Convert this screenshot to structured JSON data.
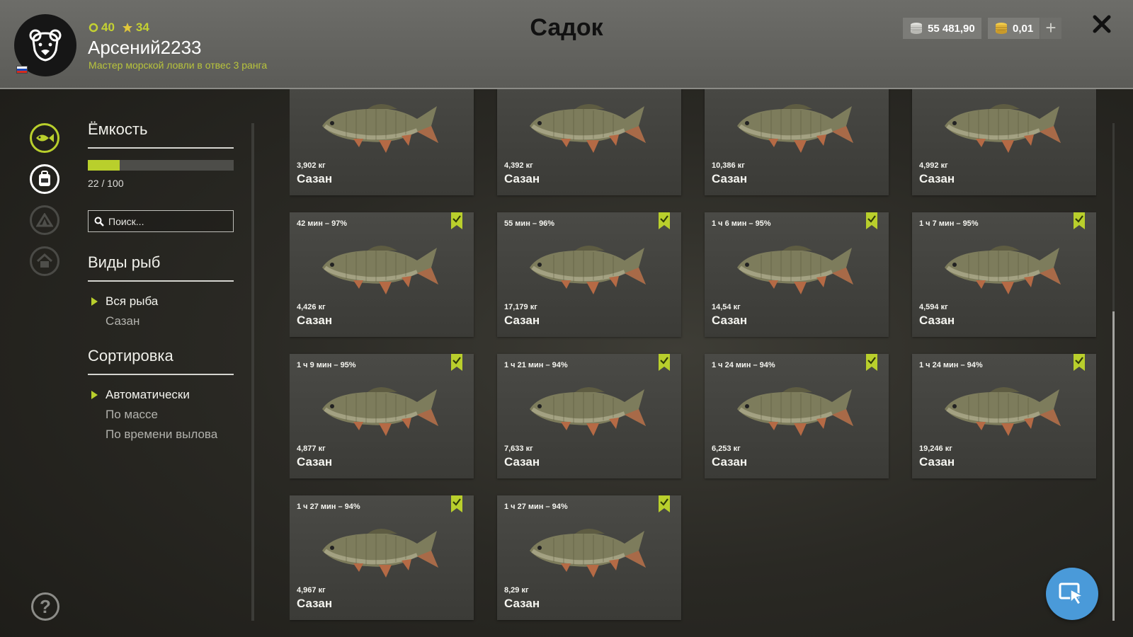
{
  "header": {
    "title": "Садок",
    "player": {
      "name": "Арсений2233",
      "rank": "Мастер морской ловли в отвес 3 ранга",
      "level": "40",
      "stars": "34",
      "avatar_icon": "bear-icon",
      "flag": "russia-flag-icon"
    },
    "currency": {
      "silver": "55 481,90",
      "gold": "0,01",
      "add_label": "+"
    }
  },
  "nav": {
    "items": [
      {
        "icon": "fish-icon",
        "state": "active"
      },
      {
        "icon": "backpack-icon",
        "state": "normal"
      },
      {
        "icon": "tent-icon",
        "state": "disabled"
      },
      {
        "icon": "house-icon",
        "state": "disabled"
      }
    ],
    "help_label": "?"
  },
  "capacity": {
    "title": "Ёмкость",
    "used": 22,
    "total": 100,
    "text": "22 / 100",
    "fill_fraction": 0.22
  },
  "search": {
    "placeholder": "Поиск..."
  },
  "species": {
    "title": "Виды рыб",
    "options": [
      {
        "label": "Вся рыба",
        "active": true
      },
      {
        "label": "Сазан",
        "active": false
      }
    ]
  },
  "sorting": {
    "title": "Сортировка",
    "options": [
      {
        "label": "Автоматически",
        "active": true
      },
      {
        "label": "По массе",
        "active": false
      },
      {
        "label": "По времени вылова",
        "active": false
      }
    ]
  },
  "fish": [
    {
      "time": "",
      "weight": "3,902 кг",
      "name": "Сазан",
      "bookmarked": false
    },
    {
      "time": "",
      "weight": "4,392 кг",
      "name": "Сазан",
      "bookmarked": false
    },
    {
      "time": "",
      "weight": "10,386 кг",
      "name": "Сазан",
      "bookmarked": false
    },
    {
      "time": "",
      "weight": "4,992 кг",
      "name": "Сазан",
      "bookmarked": false
    },
    {
      "time": "42 мин – 97%",
      "weight": "4,426 кг",
      "name": "Сазан",
      "bookmarked": true
    },
    {
      "time": "55 мин – 96%",
      "weight": "17,179 кг",
      "name": "Сазан",
      "bookmarked": true
    },
    {
      "time": "1 ч 6 мин – 95%",
      "weight": "14,54 кг",
      "name": "Сазан",
      "bookmarked": true
    },
    {
      "time": "1 ч 7 мин – 95%",
      "weight": "4,594 кг",
      "name": "Сазан",
      "bookmarked": true
    },
    {
      "time": "1 ч 9 мин – 95%",
      "weight": "4,877 кг",
      "name": "Сазан",
      "bookmarked": true
    },
    {
      "time": "1 ч 21 мин – 94%",
      "weight": "7,633 кг",
      "name": "Сазан",
      "bookmarked": true
    },
    {
      "time": "1 ч 24 мин – 94%",
      "weight": "6,253 кг",
      "name": "Сазан",
      "bookmarked": true
    },
    {
      "time": "1 ч 24 мин – 94%",
      "weight": "19,246 кг",
      "name": "Сазан",
      "bookmarked": true
    },
    {
      "time": "1 ч 27 мин – 94%",
      "weight": "4,967 кг",
      "name": "Сазан",
      "bookmarked": true
    },
    {
      "time": "1 ч 27 мин – 94%",
      "weight": "8,29 кг",
      "name": "Сазан",
      "bookmarked": true
    }
  ],
  "colors": {
    "accent": "#b9cf2c",
    "header_bg": "#6d6d69",
    "fab": "#4a9ad9"
  },
  "fab_icon": "cursor-select-icon"
}
